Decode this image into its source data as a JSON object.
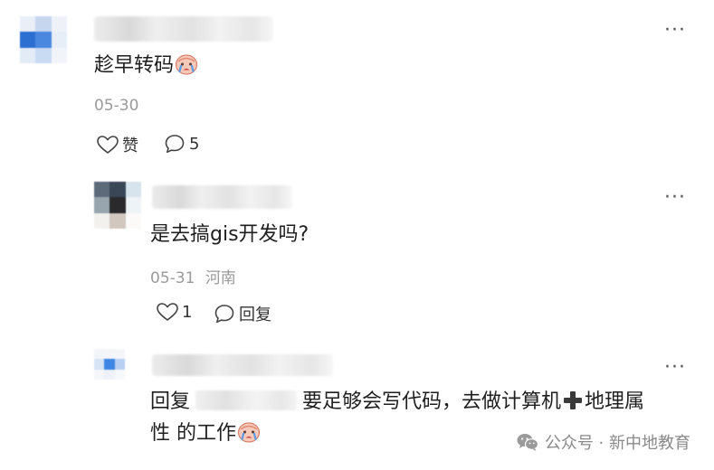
{
  "comments": [
    {
      "content": "趁早转码",
      "date": "05-30",
      "like_label": "赞",
      "reply_count": "5",
      "more_label": "···"
    },
    {
      "content": "是去搞gis开发吗?",
      "date": "05-31",
      "location": "河南",
      "like_count": "1",
      "reply_label": "回复",
      "more_label": "···"
    },
    {
      "reply_prefix": "回复",
      "content_part1": "要足够会写代码，去做计算机",
      "content_part2": "地理属",
      "content_line2": "性 的工作",
      "more_label": "···"
    }
  ],
  "watermark": {
    "text": "公众号 · 新中地教育"
  },
  "icons": {
    "more": "more-horizontal-icon",
    "like": "heart-outline-icon",
    "reply": "speech-bubble-icon",
    "emoji": "crying-face-emoji-icon",
    "plus": "heavy-plus-icon",
    "wechat": "wechat-logo-icon"
  }
}
